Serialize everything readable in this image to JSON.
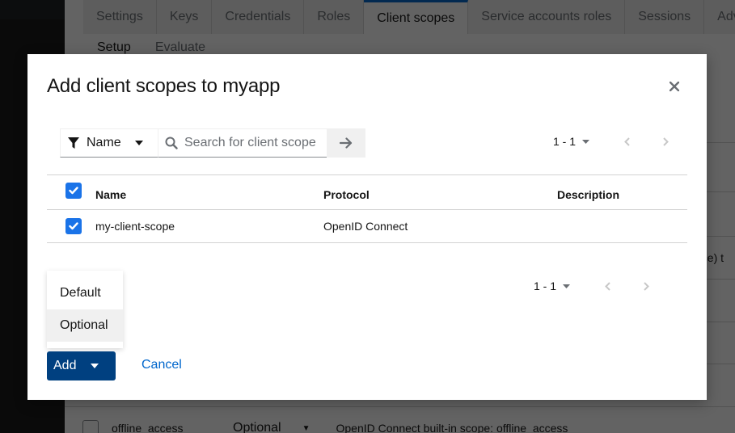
{
  "background": {
    "tabs": [
      {
        "label": "Settings",
        "active": false
      },
      {
        "label": "Keys",
        "active": false
      },
      {
        "label": "Credentials",
        "active": false
      },
      {
        "label": "Roles",
        "active": false
      },
      {
        "label": "Client scopes",
        "active": true
      },
      {
        "label": "Service accounts roles",
        "active": false
      },
      {
        "label": "Sessions",
        "active": false
      },
      {
        "label": "Adva",
        "active": false
      }
    ],
    "subtabs": [
      {
        "label": "Setup",
        "active": true
      },
      {
        "label": "Evaluate",
        "active": false
      }
    ],
    "partial_text": "nce) t",
    "bottom_row": {
      "name": "offline_access",
      "type": "Optional",
      "description": "OpenID Connect built-in scope: offline_access"
    }
  },
  "modal": {
    "title": "Add client scopes to myapp",
    "close_icon": "close-icon",
    "filter": {
      "selected": "Name",
      "icon": "filter-icon"
    },
    "search": {
      "placeholder": "Search for client scope",
      "value": "",
      "go_icon": "arrow-right-icon"
    },
    "pagination_top": {
      "range": "1 - 1"
    },
    "pagination_bottom": {
      "range": "1 - 1"
    },
    "table": {
      "headers": {
        "name": "Name",
        "protocol": "Protocol",
        "description": "Description"
      },
      "select_all_checked": true,
      "rows": [
        {
          "name": "my-client-scope",
          "protocol": "OpenID Connect",
          "description": "",
          "checked": true
        }
      ]
    },
    "add_menu": {
      "items": [
        "Default",
        "Optional"
      ],
      "hovered": "Optional"
    },
    "add_label": "Add",
    "cancel_label": "Cancel"
  },
  "colors": {
    "primary": "#004080",
    "link": "#0066cc",
    "checkbox": "#1a73e8",
    "active_tab_border": "#0066cc"
  }
}
